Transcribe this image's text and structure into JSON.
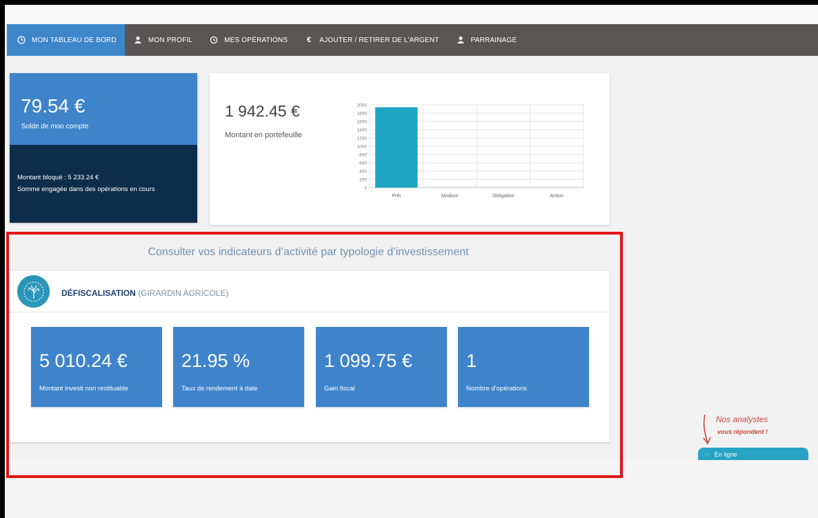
{
  "nav": {
    "items": [
      {
        "label": "MON TABLEAU DE BORD",
        "icon": "dashboard-icon"
      },
      {
        "label": "MON PROFIL",
        "icon": "user-icon"
      },
      {
        "label": "MES OPÉRATIONS",
        "icon": "history-icon"
      },
      {
        "label": "AJOUTER / RETIRER DE L'ARGENT",
        "icon": "euro-icon"
      },
      {
        "label": "PARRAINAGE",
        "icon": "user-icon"
      }
    ],
    "active_color": "#3d86c9",
    "bar_color": "#5a5555"
  },
  "balance": {
    "amount": "79.54 €",
    "label": "Solde de mon compte",
    "blocked": "Montant bloqué : 5 233.24 €",
    "blocked_desc": "Somme engagée dans des opérations en cours"
  },
  "portfolio": {
    "amount": "1 942.45 €",
    "label": "Montant en portefeuille"
  },
  "chart_data": {
    "type": "bar",
    "categories": [
      "Prêt",
      "Minibon",
      "Obligation",
      "Action"
    ],
    "values": [
      1942.45,
      0,
      0,
      0
    ],
    "ylim": [
      0,
      2000
    ],
    "yticks": [
      0,
      200,
      400,
      600,
      800,
      1000,
      1200,
      1400,
      1600,
      1800,
      2000
    ],
    "bar_color": "#1ea5c4",
    "grid": true
  },
  "section": {
    "title": "Consulter vos indicateurs d’activité par typologie d’investissement"
  },
  "panel": {
    "title": "DÉFISCALISATION",
    "subtitle": "(GIRARDIN AGRICOLE)",
    "logo_icon": "tree-icon",
    "tiles": [
      {
        "value": "5 010.24 €",
        "label": "Montant investi non restituable"
      },
      {
        "value": "21.95 %",
        "label": "Taux de rendement à date"
      },
      {
        "value": "1 099.75 €",
        "label": "Gain fiscal"
      },
      {
        "value": "1",
        "label": "Nombre d'opérations"
      }
    ]
  },
  "chat": {
    "line1": "Nos analystes",
    "line2": "vous répondent !",
    "status": "En ligne"
  },
  "highlight_color": "#e01313"
}
